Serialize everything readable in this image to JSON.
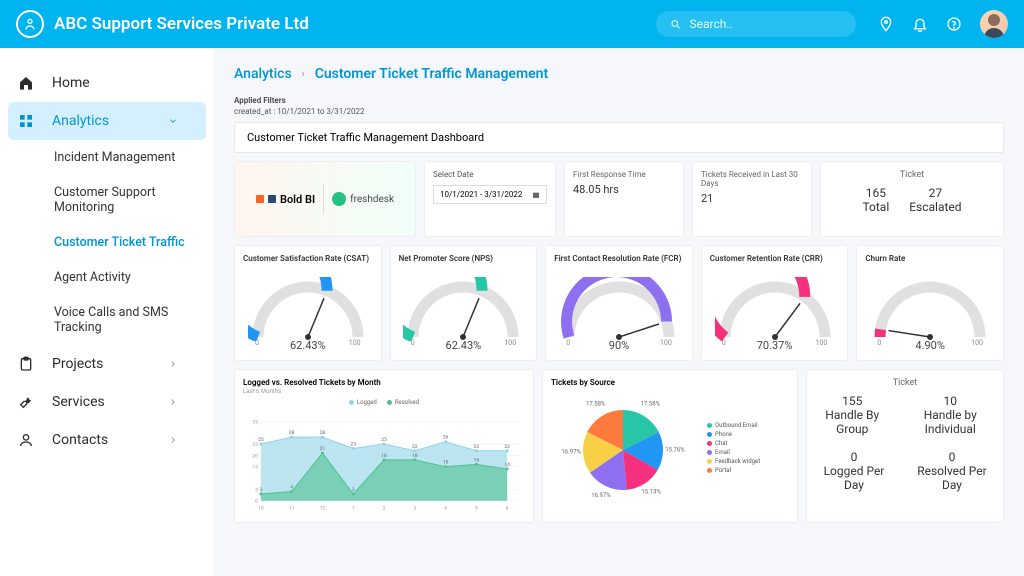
{
  "header": {
    "company": "ABC Support Services Private Ltd",
    "search_placeholder": "Search.."
  },
  "sidebar": {
    "items": [
      {
        "icon": "home",
        "label": "Home"
      },
      {
        "icon": "grid",
        "label": "Analytics",
        "expanded": true,
        "children": [
          {
            "label": "Incident Management"
          },
          {
            "label": "Customer Support Monitoring"
          },
          {
            "label": "Customer Ticket Traffic",
            "active": true
          },
          {
            "label": "Agent Activity"
          },
          {
            "label": "Voice Calls and SMS Tracking"
          }
        ]
      },
      {
        "icon": "clipboard",
        "label": "Projects"
      },
      {
        "icon": "wrench",
        "label": "Services"
      },
      {
        "icon": "person",
        "label": "Contacts"
      }
    ]
  },
  "breadcrumb": {
    "l1": "Analytics",
    "sep": "›",
    "l2": "Customer Ticket Traffic Management"
  },
  "filters": {
    "label": "Applied Filters",
    "value": "created_at : 10/1/2021 to 3/31/2022"
  },
  "dashboard_title": "Customer Ticket Traffic Management Dashboard",
  "logos": {
    "bold": "Bold BI",
    "fresh": "freshdesk"
  },
  "date_picker": {
    "label": "Select Date",
    "value": "10/1/2021 - 3/31/2022"
  },
  "kpi_response": {
    "label": "First Response Time",
    "value": "48.05 hrs"
  },
  "kpi_received": {
    "label": "Tickets Received in Last 30 Days",
    "value": "21"
  },
  "ticket_summary": {
    "header": "Ticket",
    "total": "165",
    "total_lbl": "Total",
    "esc": "27",
    "esc_lbl": "Escalated"
  },
  "gauges": [
    {
      "title": "Customer Satisfaction Rate (CSAT)",
      "value": "62.43%",
      "pct": 62.43,
      "color": "#2196f3",
      "min": "0",
      "max": "100"
    },
    {
      "title": "Net Promoter Score (NPS)",
      "value": "62.43%",
      "pct": 62.43,
      "color": "#26c6a7",
      "min": "0",
      "max": "100"
    },
    {
      "title": "First Contact Resolution Rate (FCR)",
      "value": "90%",
      "pct": 90,
      "color": "#8e6ff0",
      "min": "0",
      "max": "100"
    },
    {
      "title": "Customer Retention Rate (CRR)",
      "value": "70.37%",
      "pct": 70.37,
      "color": "#f5317f",
      "min": "0",
      "max": "100"
    },
    {
      "title": "Churn Rate",
      "value": "4.90%",
      "pct": 4.9,
      "color": "#f5317f",
      "min": "0",
      "max": "100"
    }
  ],
  "area": {
    "title": "Logged vs. Resolved Tickets by Month",
    "subtitle": "Last 6 Months",
    "legend": [
      "Logged",
      "Resolved"
    ]
  },
  "pie": {
    "title": "Tickets by Source",
    "legend": [
      "Outbound Email",
      "Phone",
      "Chat",
      "Email",
      "Feedback widget",
      "Portal"
    ]
  },
  "ticket_stats": {
    "header": "Ticket",
    "a": "155",
    "a_lbl": "Handle By Group",
    "b": "10",
    "b_lbl": "Handle by Individual",
    "c": "0",
    "c_lbl": "Logged Per Day",
    "d": "0",
    "d_lbl": "Resolved Per Day"
  },
  "chart_data": {
    "area": {
      "type": "area",
      "x": [
        "10",
        "11",
        "12",
        "1",
        "2",
        "3",
        "4",
        "5",
        "6"
      ],
      "series": [
        {
          "name": "Logged",
          "values": [
            25,
            28,
            28,
            23,
            25,
            22,
            26,
            22,
            22
          ],
          "color": "#8fd4e8"
        },
        {
          "name": "Resolved",
          "values": [
            3,
            4,
            21,
            3,
            18,
            18,
            15,
            16,
            14
          ],
          "color": "#4fc28f"
        }
      ],
      "ylim": [
        0,
        35
      ]
    },
    "pie": {
      "type": "pie",
      "slices": [
        {
          "label": "Outbound Email",
          "value": 17.58,
          "color": "#26c6a7"
        },
        {
          "label": "Phone",
          "value": 15.76,
          "color": "#2196f3"
        },
        {
          "label": "Chat",
          "value": 15.13,
          "color": "#f5317f"
        },
        {
          "label": "Email",
          "value": 16.97,
          "color": "#8e6ff0"
        },
        {
          "label": "Feedback widget",
          "value": 16.97,
          "color": "#f7d046"
        },
        {
          "label": "Portal",
          "value": 17.58,
          "color": "#ff7a3d"
        }
      ]
    }
  }
}
